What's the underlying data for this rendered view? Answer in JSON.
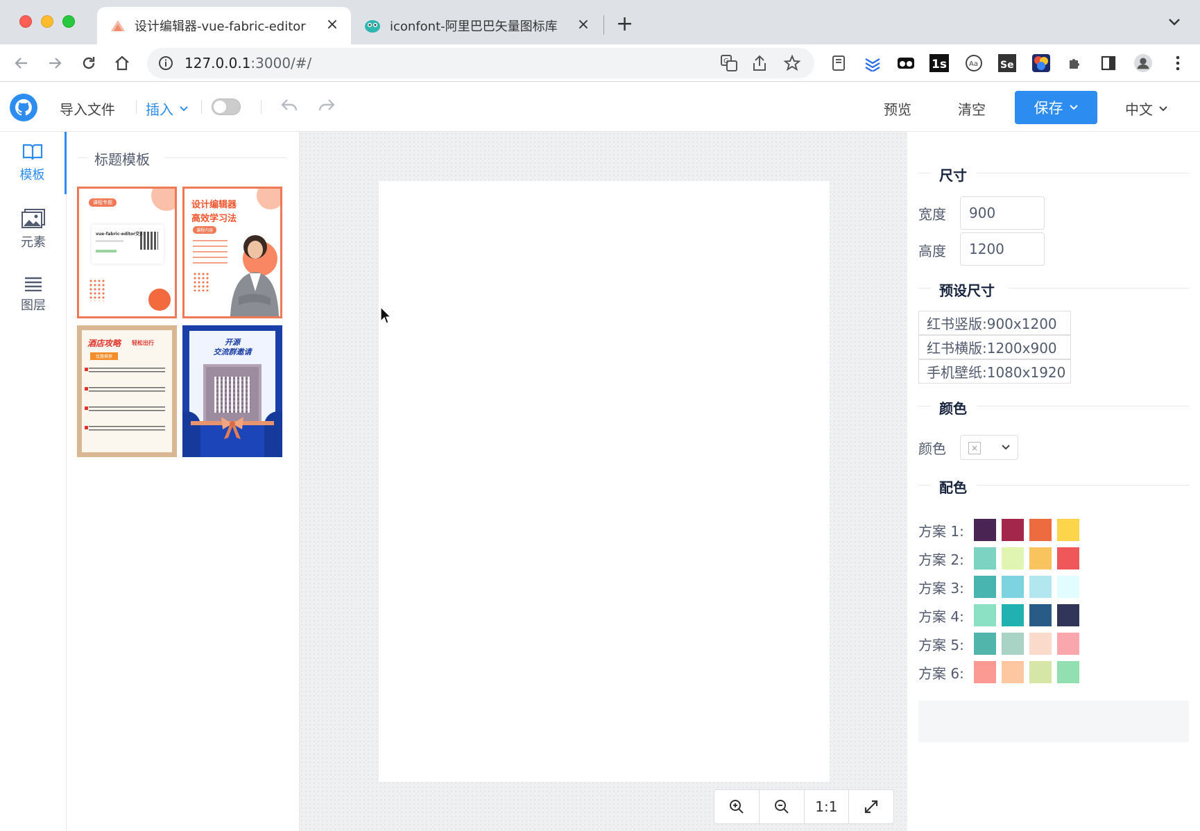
{
  "browser": {
    "tabs": [
      {
        "title": "设计编辑器-vue-fabric-editor",
        "active": true
      },
      {
        "title": "iconfont-阿里巴巴矢量图标库",
        "active": false
      }
    ],
    "url_host": "127.0.0.1",
    "url_rest": ":3000/#/"
  },
  "header": {
    "import_label": "导入文件",
    "insert_label": "插入",
    "preview_label": "预览",
    "clear_label": "清空",
    "save_label": "保存",
    "language_label": "中文"
  },
  "rail": {
    "items": [
      {
        "label": "模板",
        "active": true
      },
      {
        "label": "元素",
        "active": false
      },
      {
        "label": "图层",
        "active": false
      }
    ]
  },
  "templates": {
    "section_title": "标题模板",
    "items": [
      {
        "title_a": "vue-fabric-editor交流",
        "tag": "课程专题"
      },
      {
        "title_a": "设计编辑器",
        "title_b": "高效学习法",
        "tag": "课程内容"
      },
      {
        "title_a": "酒店攻略",
        "title_b": "轻松出行",
        "tag": "优惠推荐"
      },
      {
        "title_a": "开源",
        "title_b": "交流群邀请"
      }
    ]
  },
  "zoom": {
    "fit_label": "1:1"
  },
  "properties": {
    "size_title": "尺寸",
    "width_label": "宽度",
    "width_value": "900",
    "height_label": "高度",
    "height_value": "1200",
    "preset_title": "预设尺寸",
    "presets": [
      "红书竖版:900x1200",
      "红书横版:1200x900",
      "手机壁纸:1080x1920"
    ],
    "color_title": "颜色",
    "color_label": "颜色",
    "palette_title": "配色",
    "schemes": [
      {
        "label": "方案 1:",
        "colors": [
          "#4a2452",
          "#a3274a",
          "#ee6a3f",
          "#fcd54b"
        ]
      },
      {
        "label": "方案 2:",
        "colors": [
          "#7cd3c2",
          "#dff5b1",
          "#f9c35e",
          "#ef5758"
        ]
      },
      {
        "label": "方案 3:",
        "colors": [
          "#48b5b0",
          "#7dd3df",
          "#b2e7ef",
          "#e2fdff"
        ]
      },
      {
        "label": "方案 4:",
        "colors": [
          "#8ce1c4",
          "#22b1b1",
          "#285b86",
          "#31355a"
        ]
      },
      {
        "label": "方案 5:",
        "colors": [
          "#52b5ab",
          "#a9d3c4",
          "#f9dacb",
          "#f9a7ac"
        ]
      },
      {
        "label": "方案 6:",
        "colors": [
          "#fb9a93",
          "#fdc8a1",
          "#d5e6a6",
          "#92dfb1"
        ]
      }
    ]
  }
}
